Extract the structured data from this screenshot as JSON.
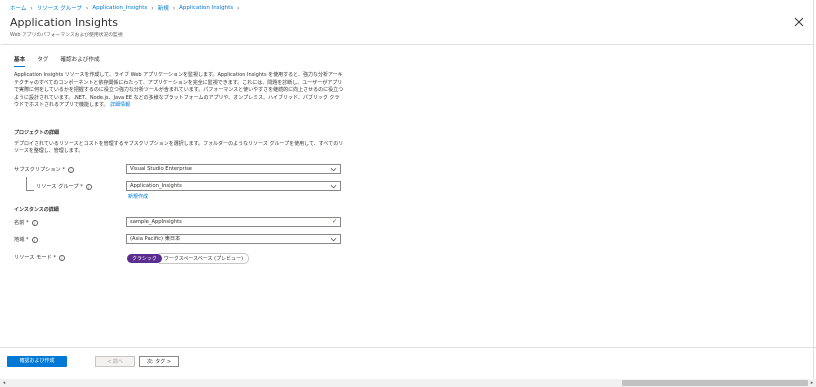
{
  "breadcrumb": [
    "ホーム",
    "リソース グループ",
    "Application_Insights",
    "新規",
    "Application Insights"
  ],
  "title": "Application Insights",
  "subtitle": "Web アプリのパフォーマンスおよび使用状況の監視",
  "tabs": [
    "基本",
    "タグ",
    "確認および作成"
  ],
  "description": "Application Insights リソースを作成して、ライブ Web アプリケーションを監視します。Application Insights を使用すると、強力な分析アーキテクチャのすべてのコンポーネントと依存関係にわたって、アプリケーションを完全に監視できます。これには、問題を診断し、ユーザーがアプリで実際に何をしているかを把握するのに役立つ強力な分析ツールが含まれています。パフォーマンスと使いやすさを継続的に向上させるのに役立つように設計されています。.NET、Node.js、Java EE などの多様なプラットフォームのアプリや、オンプレミス、ハイブリッド、パブリック クラウドでホストされるアプリで機能します。",
  "description_link": "詳細情報",
  "project": {
    "heading": "プロジェクトの詳細",
    "desc": "デプロイされているリソースとコストを管理するサブスクリプションを選択します。フォルダーのようなリソース グループを使用して、すべてのリソースを整理し、管理します。",
    "subscription_label": "サブスクリプション *",
    "subscription_value": "Visual Studio Enterprise",
    "rg_label": "リソース グループ *",
    "rg_value": "Application_Insights",
    "create_new": "新規作成"
  },
  "instance": {
    "heading": "インスタンスの詳細",
    "name_label": "名前 *",
    "name_value": "sample_AppInsights",
    "region_label": "地域 *",
    "region_value": "(Asia Pacific) 東日本",
    "mode_label": "リソース モード *",
    "mode_selected": "クラシック",
    "mode_alt": "ワークスペースベース (プレビュー)"
  },
  "footer": {
    "review_create": "確認および作成",
    "prev": "< 前へ",
    "next": "次: タグ >"
  },
  "colors": {
    "accent": "#0078d4",
    "toggle": "#5c2d91"
  }
}
